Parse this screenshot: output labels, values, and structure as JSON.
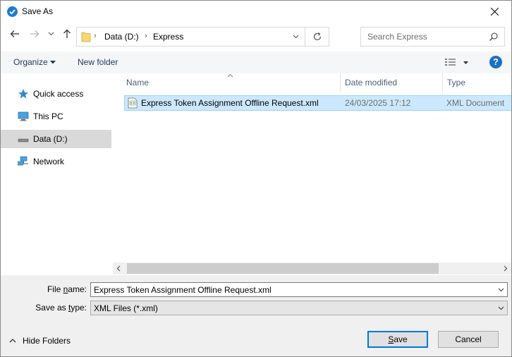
{
  "window": {
    "title": "Save As"
  },
  "address": {
    "crumbs": [
      "Data (D:)",
      "Express"
    ]
  },
  "search": {
    "placeholder": "Search Express"
  },
  "commands": {
    "organize": "Organize",
    "new_folder": "New folder",
    "help": "?"
  },
  "nav_pane": {
    "items": [
      {
        "label": "Quick access",
        "icon": "star-icon"
      },
      {
        "label": "This PC",
        "icon": "computer-icon"
      },
      {
        "label": "Data (D:)",
        "icon": "drive-icon",
        "selected": true
      },
      {
        "label": "Network",
        "icon": "network-icon"
      }
    ]
  },
  "file_list": {
    "columns": [
      "Name",
      "Date modified",
      "Type"
    ],
    "rows": [
      {
        "name": "Express Token Assignment Offline Request.xml",
        "date": "24/03/2025 17:12",
        "type": "XML Document",
        "selected": true
      }
    ]
  },
  "form": {
    "file_name_label_pre": "File ",
    "file_name_label_accel": "n",
    "file_name_label_post": "ame:",
    "file_name_value": "Express Token Assignment Offline Request.xml",
    "save_type_label_pre": "Save as ",
    "save_type_label_accel": "t",
    "save_type_label_post": "ype:",
    "save_type_value": "XML Files (*.xml)"
  },
  "footer": {
    "hide_folders": "Hide Folders",
    "save_accel": "S",
    "save_rest": "ave",
    "cancel": "Cancel"
  },
  "colors": {
    "accent": "#0078d7",
    "selection": "#cce8ff",
    "command_text": "#1e395b"
  }
}
